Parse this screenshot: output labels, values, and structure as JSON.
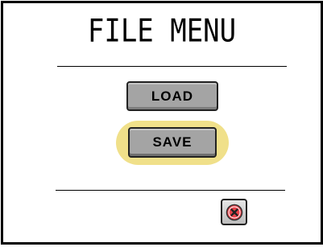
{
  "window": {
    "title": "FILE MENU"
  },
  "buttons": {
    "load_label": "LOAD",
    "save_label": "SAVE",
    "close_icon": "close-icon"
  },
  "state": {
    "highlighted_button": "SAVE"
  },
  "colors": {
    "button_face": "#a4a4a4",
    "highlight": "#f0e08a",
    "close_icon_fill": "#e8424a"
  }
}
